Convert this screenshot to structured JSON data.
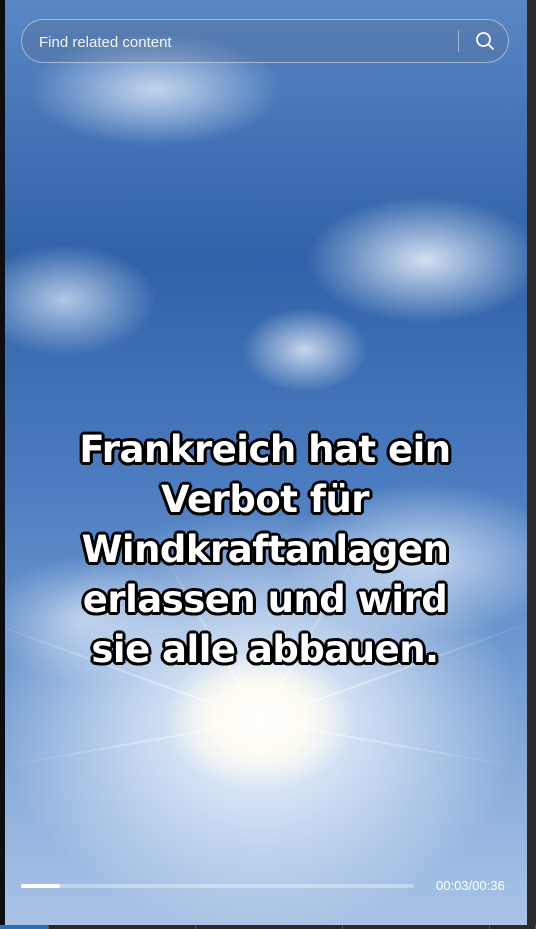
{
  "search": {
    "placeholder": "Find related content",
    "icon": "search-icon"
  },
  "video": {
    "caption": "Frankreich hat ein Verbot für Windkraftanlagen erlassen und wird sie alle abbauen.",
    "current_time": "00:03",
    "duration": "00:36",
    "time_display": "00:03/00:36",
    "progress": 0.1
  },
  "colors": {
    "sky_blue": "#2f62a8",
    "caption_text": "#ffffff",
    "caption_outline": "#000000"
  }
}
